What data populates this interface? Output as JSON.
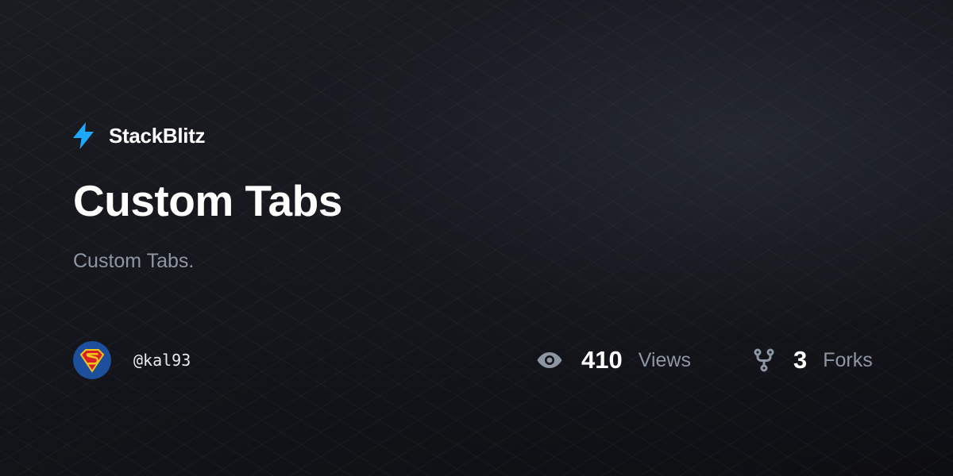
{
  "brand": {
    "name": "StackBlitz",
    "icon": "lightning-bolt-icon",
    "accent_color": "#1ea7fd"
  },
  "project": {
    "title": "Custom Tabs",
    "description": "Custom Tabs."
  },
  "author": {
    "username": "@kal93",
    "avatar": "superman-logo-avatar"
  },
  "stats": {
    "views": {
      "icon": "eye-icon",
      "count": "410",
      "label": "Views"
    },
    "forks": {
      "icon": "fork-icon",
      "count": "3",
      "label": "Forks"
    }
  }
}
